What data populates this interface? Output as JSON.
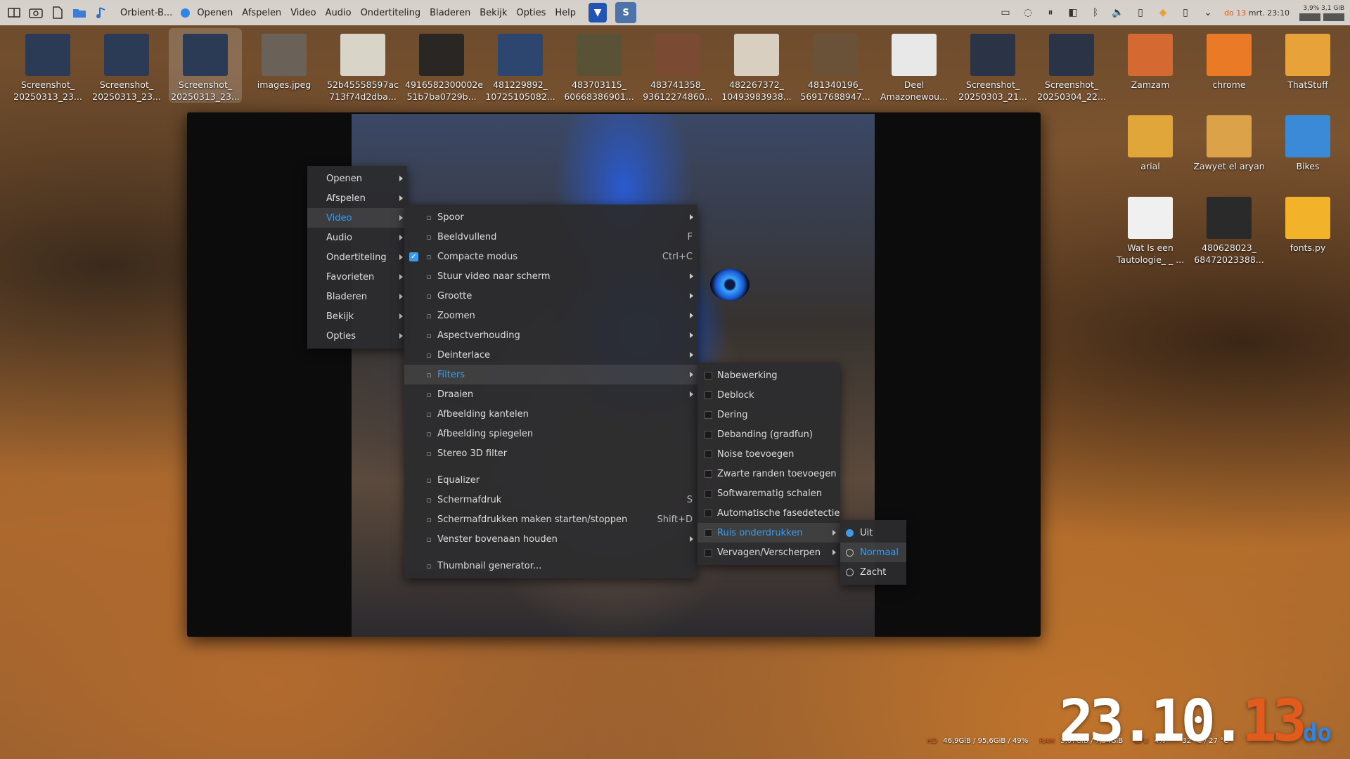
{
  "topbar": {
    "app_title": "Orbient-B...",
    "menu": [
      "Openen",
      "Afspelen",
      "Video",
      "Audio",
      "Ondertiteling",
      "Bladeren",
      "Bekijk",
      "Opties",
      "Help"
    ],
    "tray": {
      "date_day": "do 13",
      "date_rest": "mrt. 23:10",
      "meter_cpu": "3,9%",
      "meter_mem": "3,1 GiB"
    }
  },
  "desktop_icons": [
    {
      "label": "Screenshot_ 20250313_23...",
      "color": "#2b3b55"
    },
    {
      "label": "Screenshot_ 20250313_23...",
      "color": "#2b3b55"
    },
    {
      "label": "Screenshot_ 20250313_23...",
      "color": "#2b3b55"
    },
    {
      "label": "images.jpeg",
      "color": "#6a6258"
    },
    {
      "label": "52b45558597ac 713f74d2dba...",
      "color": "#d8d4c8"
    },
    {
      "label": "4916582300002e 51b7ba0729b...",
      "color": "#2a2624"
    },
    {
      "label": "481229892_ 10725105082...",
      "color": "#2c4670"
    },
    {
      "label": "483703115_ 60668386901...",
      "color": "#5a5236"
    },
    {
      "label": "483741358_ 93612274860...",
      "color": "#7a4a32"
    },
    {
      "label": "482267372_ 10493983938...",
      "color": "#d8cfc0"
    },
    {
      "label": "481340196_ 56917688947...",
      "color": "#6a5238"
    },
    {
      "label": "Deel Amazonewou...",
      "color": "#e8e8e8"
    },
    {
      "label": "Screenshot_ 20250303_21...",
      "color": "#2b3346"
    },
    {
      "label": "Screenshot_ 20250304_22...",
      "color": "#2b3346"
    },
    {
      "label": "Zamzam",
      "color": "#d46a32"
    },
    {
      "label": "chrome",
      "color": "#ea7a26"
    },
    {
      "label": "ThatStuff",
      "color": "#e8a23a"
    },
    {
      "label": "arial",
      "color": "#e0a63a"
    },
    {
      "label": "Zawyet el aryan",
      "color": "#dba24a"
    },
    {
      "label": "Bikes",
      "color": "#3a8ad8"
    },
    {
      "label": "Wat Is een Tautologie_ _ ...",
      "color": "#f0f0f0"
    },
    {
      "label": "480628023_ 68472023388...",
      "color": "#2a2a2a"
    },
    {
      "label": "fonts.py",
      "color": "#f2b22a"
    }
  ],
  "menu_main": [
    {
      "label": "Openen",
      "submenu": true
    },
    {
      "label": "Afspelen",
      "submenu": true
    },
    {
      "label": "Video",
      "submenu": true,
      "highlight": true
    },
    {
      "label": "Audio",
      "submenu": true
    },
    {
      "label": "Ondertiteling",
      "submenu": true
    },
    {
      "label": "Favorieten",
      "submenu": true
    },
    {
      "label": "Bladeren",
      "submenu": true
    },
    {
      "label": "Bekijk",
      "submenu": true
    },
    {
      "label": "Opties",
      "submenu": true
    }
  ],
  "menu_video": [
    {
      "label": "Spoor",
      "submenu": true
    },
    {
      "label": "Beeldvullend",
      "shortcut": "F"
    },
    {
      "label": "Compacte modus",
      "shortcut": "Ctrl+C",
      "checked": true
    },
    {
      "label": "Stuur video naar scherm",
      "submenu": true
    },
    {
      "label": "Grootte",
      "submenu": true
    },
    {
      "label": "Zoomen",
      "submenu": true
    },
    {
      "label": "Aspectverhouding",
      "submenu": true
    },
    {
      "label": "Deinterlace",
      "submenu": true
    },
    {
      "label": "Filters",
      "submenu": true,
      "highlight": true
    },
    {
      "label": "Draaien",
      "submenu": true
    },
    {
      "label": "Afbeelding kantelen"
    },
    {
      "label": "Afbeelding spiegelen"
    },
    {
      "label": "Stereo 3D filter"
    },
    {
      "separator": true
    },
    {
      "label": "Equalizer"
    },
    {
      "label": "Schermafdruk",
      "shortcut": "S"
    },
    {
      "label": "Schermafdrukken maken starten/stoppen",
      "shortcut": "Shift+D"
    },
    {
      "label": "Venster bovenaan houden",
      "submenu": true
    },
    {
      "separator": true
    },
    {
      "label": "Thumbnail generator..."
    }
  ],
  "menu_filters": [
    {
      "label": "Nabewerking"
    },
    {
      "label": "Deblock"
    },
    {
      "label": "Dering"
    },
    {
      "label": "Debanding (gradfun)"
    },
    {
      "label": "Noise toevoegen"
    },
    {
      "label": "Zwarte randen toevoegen"
    },
    {
      "label": "Softwarematig schalen"
    },
    {
      "label": "Automatische fasedetectie"
    },
    {
      "label": "Ruis onderdrukken",
      "submenu": true,
      "highlight": true
    },
    {
      "label": "Vervagen/Verscherpen",
      "submenu": true
    }
  ],
  "menu_noise": [
    {
      "label": "Uit",
      "selected": true
    },
    {
      "label": "Normaal",
      "highlight": true
    },
    {
      "label": "Zacht"
    }
  ],
  "bottom": {
    "clock_hm": "23.10.",
    "clock_day": "13",
    "clock_dow": "do",
    "stats": [
      {
        "key": "HD",
        "value": "46,9GiB / 95,6GiB / 49%"
      },
      {
        "key": "RAM",
        "value": "3,07GiB / 7,54GiB"
      },
      {
        "key": "CPU",
        "value": "4%"
      },
      {
        "key": "",
        "value": "32 °C / 27 °C"
      }
    ]
  },
  "colors": {
    "accent": "#3d9be9",
    "orange": "#e25a1c"
  }
}
